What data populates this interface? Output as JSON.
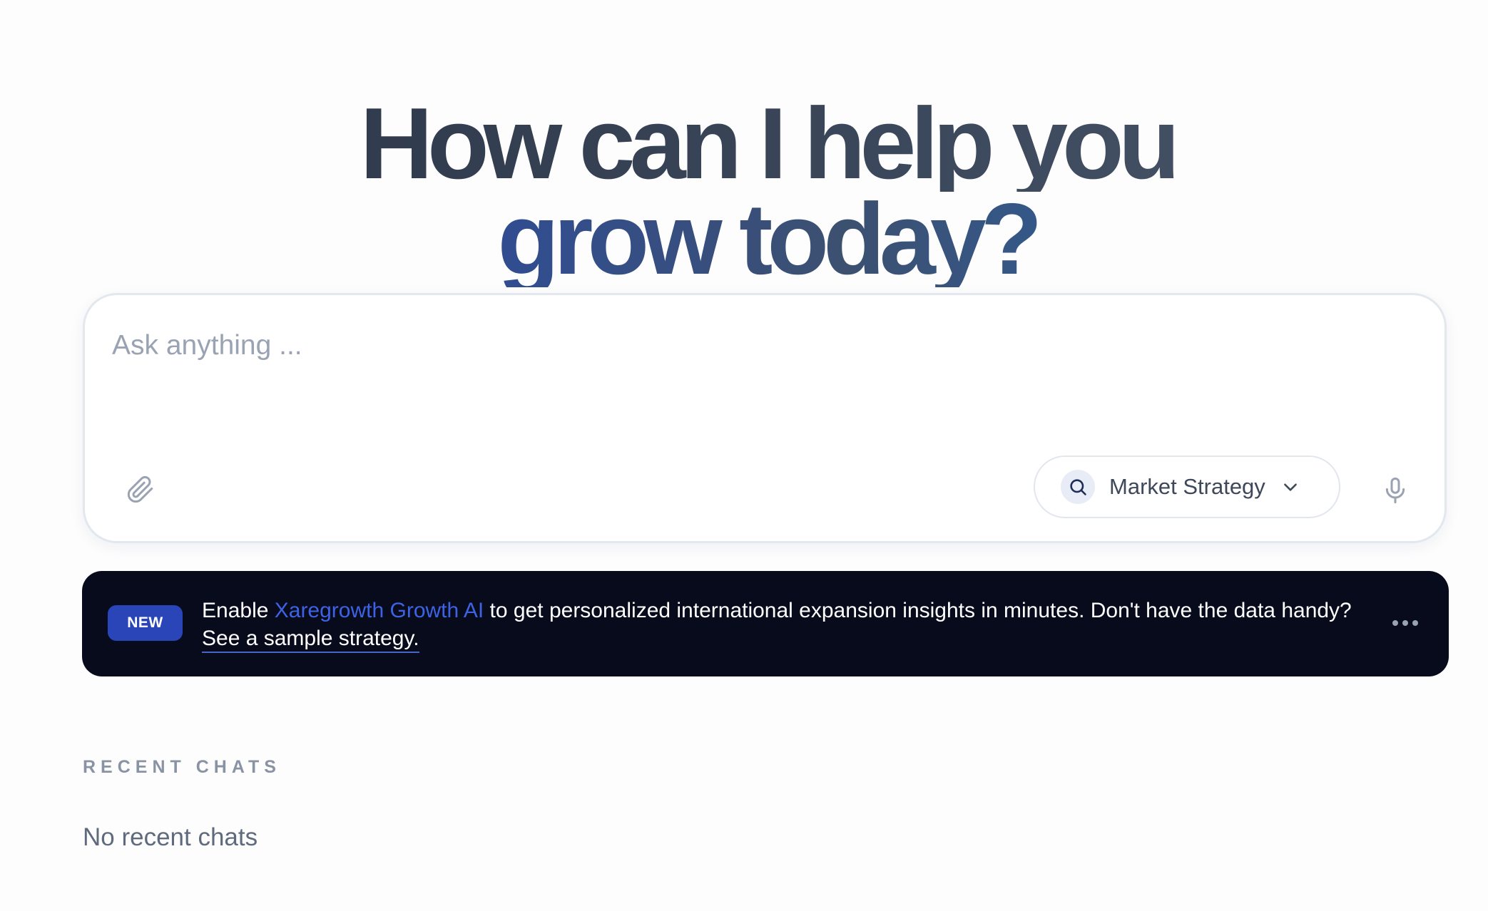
{
  "hero": {
    "line1": "How can I help you",
    "line2": "grow today?"
  },
  "composer": {
    "placeholder": "Ask anything ...",
    "value": "",
    "mode": {
      "label": "Market Strategy",
      "icon": "search-icon"
    },
    "attach_icon": "paperclip-icon",
    "mic_icon": "microphone-icon"
  },
  "banner": {
    "badge": "NEW",
    "text_before": "Enable ",
    "brand": "Xaregrowth Growth AI",
    "text_after": " to get personalized international expansion insights in minutes. Don't have the data handy? ",
    "link": "See a sample strategy.",
    "more_icon": "more-horizontal-icon"
  },
  "recent": {
    "heading": "RECENT CHATS",
    "empty": "No recent chats"
  },
  "colors": {
    "accent": "#2a45b8",
    "brand_text": "#3d63e4",
    "banner_bg": "#070b1c",
    "hero_text": "#2f3a4d"
  }
}
